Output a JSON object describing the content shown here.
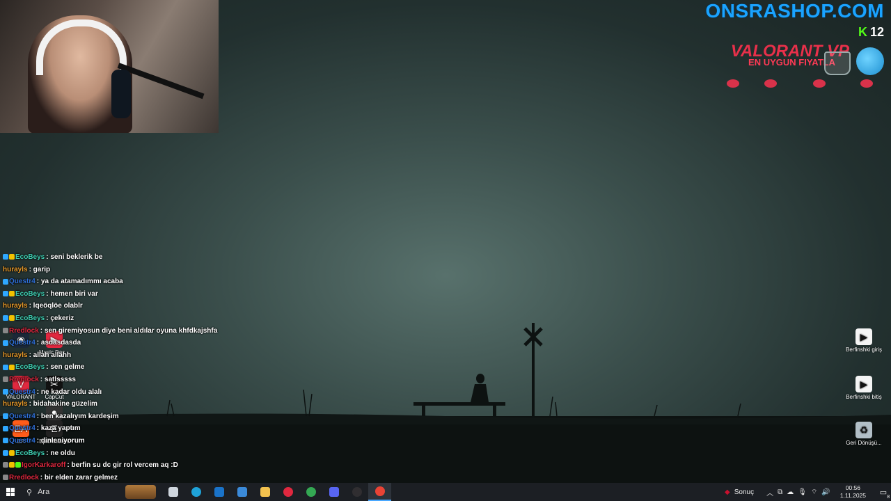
{
  "overlay": {
    "shop": "ONSRASHOP.COM",
    "kick_logo": "K",
    "kick_count": "12",
    "valorant_title": "VALORANT VP",
    "valorant_sub": "EN UYGUN FIYATLA"
  },
  "chat": [
    {
      "user": "EcoBeys",
      "color": "#3fd0b4",
      "badges": [
        "#2fa8ff",
        "#f2c200"
      ],
      "text": ": seni beklerik be"
    },
    {
      "user": "hurayls",
      "color": "#e89a2a",
      "badges": [],
      "text": ": garip"
    },
    {
      "user": "Questr4",
      "color": "#2f70d8",
      "badges": [
        "#2fa8ff"
      ],
      "text": ": ya da atamadımmı acaba"
    },
    {
      "user": "EcoBeys",
      "color": "#3fd0b4",
      "badges": [
        "#2fa8ff",
        "#f2c200"
      ],
      "text": ": hemen biri var"
    },
    {
      "user": "hurayls",
      "color": "#e89a2a",
      "badges": [],
      "text": ": lqeöqlöe olablr"
    },
    {
      "user": "EcoBeys",
      "color": "#3fd0b4",
      "badges": [
        "#2fa8ff",
        "#f2c200"
      ],
      "text": ": çekeriz"
    },
    {
      "user": "Rredlock",
      "color": "#e0283f",
      "badges": [
        "#888"
      ],
      "text": ": sen giremiyosun diye beni aldılar oyuna khfdkajshfa"
    },
    {
      "user": "Questr4",
      "color": "#2f70d8",
      "badges": [
        "#2fa8ff"
      ],
      "text": ": asdasdasda"
    },
    {
      "user": "hurayls",
      "color": "#e89a2a",
      "badges": [],
      "text": ": allah allahh"
    },
    {
      "user": "EcoBeys",
      "color": "#3fd0b4",
      "badges": [
        "#2fa8ff",
        "#f2c200"
      ],
      "text": ": sen gelme"
    },
    {
      "user": "Rredlock",
      "color": "#e0283f",
      "badges": [
        "#888"
      ],
      "text": ": satlsssss"
    },
    {
      "user": "Questr4",
      "color": "#2f70d8",
      "badges": [
        "#2fa8ff"
      ],
      "text": ": ne kadar oldu alalı"
    },
    {
      "user": "hurayls",
      "color": "#e89a2a",
      "badges": [],
      "text": ": bidahakine güzelim"
    },
    {
      "user": "Questr4",
      "color": "#2f70d8",
      "badges": [
        "#2fa8ff"
      ],
      "text": ": ben kazalıyım kardeşim"
    },
    {
      "user": "Questr4",
      "color": "#2f70d8",
      "badges": [
        "#2fa8ff"
      ],
      "text": ": kaza yaptım"
    },
    {
      "user": "Questr4",
      "color": "#2f70d8",
      "badges": [
        "#2fa8ff"
      ],
      "text": ": dinleniyorum"
    },
    {
      "user": "EcoBeys",
      "color": "#3fd0b4",
      "badges": [
        "#2fa8ff",
        "#f2c200"
      ],
      "text": ": ne oldu"
    },
    {
      "user": "IgorKarkaroff",
      "color": "#e0283f",
      "badges": [
        "#888",
        "#f2c200",
        "#53fc18"
      ],
      "text": ": berfin su dc gir rol vercem aq :D"
    },
    {
      "user": "Rredlock",
      "color": "#e0283f",
      "badges": [
        "#888"
      ],
      "text": ": bir elden zarar gelmez"
    }
  ],
  "desktop_left": [
    {
      "name": "steam-icon",
      "label": "",
      "color": "#1b2838",
      "glyph": "◉"
    },
    {
      "name": "music-icon",
      "label": "Music Des...",
      "color": "#e0283f",
      "glyph": "▶"
    },
    {
      "name": "valorant-icon",
      "label": "VALORANT",
      "color": "#e0283f",
      "glyph": "V"
    },
    {
      "name": "capcut-icon",
      "label": "CapCut",
      "color": "#111",
      "glyph": "✂"
    },
    {
      "name": "studio-icon",
      "label": "Studio",
      "color": "#333",
      "glyph": "●"
    },
    {
      "name": "ea-icon",
      "label": "EA",
      "color": "#ff5c1a",
      "glyph": "EA"
    },
    {
      "name": "epic-games-icon",
      "label": "Epic Games",
      "color": "#222",
      "glyph": "E"
    }
  ],
  "desktop_right": [
    {
      "name": "berfin-giris-icon",
      "label": "Berfinshki giriş"
    },
    {
      "name": "berfin-bitis-icon",
      "label": "Berfinshki bitiş"
    },
    {
      "name": "recycle-bin-icon",
      "label": "Geri Dönüşü..."
    }
  ],
  "taskbar": {
    "search_placeholder": "Ara",
    "apps": [
      {
        "name": "task-view-icon",
        "color": "#cfd6de"
      },
      {
        "name": "edge-icon",
        "color": "#1fa2d8"
      },
      {
        "name": "outlook-icon",
        "color": "#1a73c9"
      },
      {
        "name": "store-icon",
        "color": "#3b8ad9"
      },
      {
        "name": "file-explorer-icon",
        "color": "#f2c14e"
      },
      {
        "name": "media-player-icon",
        "color": "#e0283f"
      },
      {
        "name": "chrome-icon",
        "color": "#34a853"
      },
      {
        "name": "discord-icon",
        "color": "#5865f2"
      },
      {
        "name": "obs-icon",
        "color": "#302e31"
      },
      {
        "name": "chrome-active-icon",
        "color": "#ea4335"
      }
    ],
    "tray_label": "Sonuç",
    "time": "00:56",
    "date": "1.11.2025",
    "notification_count": "8"
  }
}
